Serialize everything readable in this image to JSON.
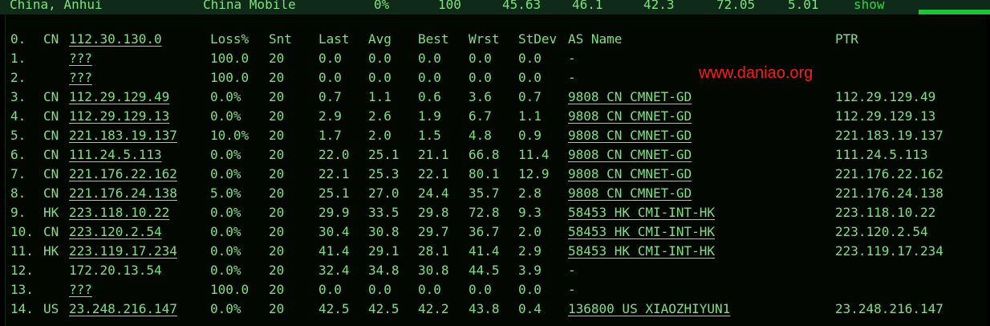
{
  "top_row": {
    "location": "China, Anhui",
    "isp": "China Mobile",
    "loss": "0%",
    "sent": "100",
    "v1": "45.63",
    "v2": "46.1",
    "v3": "42.3",
    "v4": "72.05",
    "v5": "5.01",
    "show_link": "show"
  },
  "watermark": "www.daniao.org",
  "header": {
    "hop": "0.",
    "cc": "CN",
    "host": "112.30.130.0",
    "loss": "Loss%",
    "snt": "Snt",
    "last": "Last",
    "avg": "Avg",
    "best": "Best",
    "wrst": "Wrst",
    "stdev": "StDev",
    "as_name": "AS Name",
    "ptr": "PTR"
  },
  "hops": [
    {
      "hop": "1.",
      "cc": "",
      "host": "???",
      "loss": "100.0",
      "snt": "20",
      "last": "0.0",
      "avg": "0.0",
      "best": "0.0",
      "wrst": "0.0",
      "stdev": "0.0",
      "as_name": "-",
      "ptr": ""
    },
    {
      "hop": "2.",
      "cc": "",
      "host": "???",
      "loss": "100.0",
      "snt": "20",
      "last": "0.0",
      "avg": "0.0",
      "best": "0.0",
      "wrst": "0.0",
      "stdev": "0.0",
      "as_name": "-",
      "ptr": ""
    },
    {
      "hop": "3.",
      "cc": "CN",
      "host": "112.29.129.49",
      "loss": "0.0%",
      "snt": "20",
      "last": "0.7",
      "avg": "1.1",
      "best": "0.6",
      "wrst": "3.6",
      "stdev": "0.7",
      "as_name": "9808  CN CMNET-GD",
      "ptr": "112.29.129.49"
    },
    {
      "hop": "4.",
      "cc": "CN",
      "host": "112.29.129.13",
      "loss": "0.0%",
      "snt": "20",
      "last": "2.9",
      "avg": "2.6",
      "best": "1.9",
      "wrst": "6.7",
      "stdev": "1.1",
      "as_name": "9808  CN CMNET-GD",
      "ptr": "112.29.129.13"
    },
    {
      "hop": "5.",
      "cc": "CN",
      "host": "221.183.19.137",
      "loss": "10.0%",
      "snt": "20",
      "last": "1.7",
      "avg": "2.0",
      "best": "1.5",
      "wrst": "4.8",
      "stdev": "0.9",
      "as_name": "9808  CN CMNET-GD",
      "ptr": "221.183.19.137"
    },
    {
      "hop": "6.",
      "cc": "CN",
      "host": "111.24.5.113",
      "loss": "0.0%",
      "snt": "20",
      "last": "22.0",
      "avg": "25.1",
      "best": "21.1",
      "wrst": "66.8",
      "stdev": "11.4",
      "as_name": "9808  CN CMNET-GD",
      "ptr": "111.24.5.113"
    },
    {
      "hop": "7.",
      "cc": "CN",
      "host": "221.176.22.162",
      "loss": "0.0%",
      "snt": "20",
      "last": "22.1",
      "avg": "25.3",
      "best": "22.1",
      "wrst": "80.1",
      "stdev": "12.9",
      "as_name": "9808  CN CMNET-GD",
      "ptr": "221.176.22.162"
    },
    {
      "hop": "8.",
      "cc": "CN",
      "host": "221.176.24.138",
      "loss": "5.0%",
      "snt": "20",
      "last": "25.1",
      "avg": "27.0",
      "best": "24.4",
      "wrst": "35.7",
      "stdev": "2.8",
      "as_name": "9808  CN CMNET-GD",
      "ptr": "221.176.24.138"
    },
    {
      "hop": "9.",
      "cc": "HK",
      "host": "223.118.10.22",
      "loss": "0.0%",
      "snt": "20",
      "last": "29.9",
      "avg": "33.5",
      "best": "29.8",
      "wrst": "72.8",
      "stdev": "9.3",
      "as_name": "58453 HK CMI-INT-HK",
      "ptr": "223.118.10.22"
    },
    {
      "hop": "10.",
      "cc": "CN",
      "host": "223.120.2.54",
      "loss": "0.0%",
      "snt": "20",
      "last": "30.4",
      "avg": "30.8",
      "best": "29.7",
      "wrst": "36.7",
      "stdev": "2.0",
      "as_name": "58453 HK CMI-INT-HK",
      "ptr": "223.120.2.54"
    },
    {
      "hop": "11.",
      "cc": "HK",
      "host": "223.119.17.234",
      "loss": "0.0%",
      "snt": "20",
      "last": "41.4",
      "avg": "29.1",
      "best": "28.1",
      "wrst": "41.4",
      "stdev": "2.9",
      "as_name": "58453 HK CMI-INT-HK",
      "ptr": "223.119.17.234"
    },
    {
      "hop": "12.",
      "cc": "",
      "host": "172.20.13.54",
      "loss": "0.0%",
      "snt": "20",
      "last": "32.4",
      "avg": "34.8",
      "best": "30.8",
      "wrst": "44.5",
      "stdev": "3.9",
      "as_name": "-",
      "ptr": ""
    },
    {
      "hop": "13.",
      "cc": "",
      "host": "???",
      "loss": "100.0",
      "snt": "20",
      "last": "0.0",
      "avg": "0.0",
      "best": "0.0",
      "wrst": "0.0",
      "stdev": "0.0",
      "as_name": "-",
      "ptr": ""
    },
    {
      "hop": "14.",
      "cc": "US",
      "host": "23.248.216.147",
      "loss": "0.0%",
      "snt": "20",
      "last": "42.5",
      "avg": "42.5",
      "best": "42.2",
      "wrst": "43.8",
      "stdev": "0.4",
      "as_name": "136800 US XIAOZHIYUN1",
      "ptr": "23.248.216.147"
    }
  ]
}
